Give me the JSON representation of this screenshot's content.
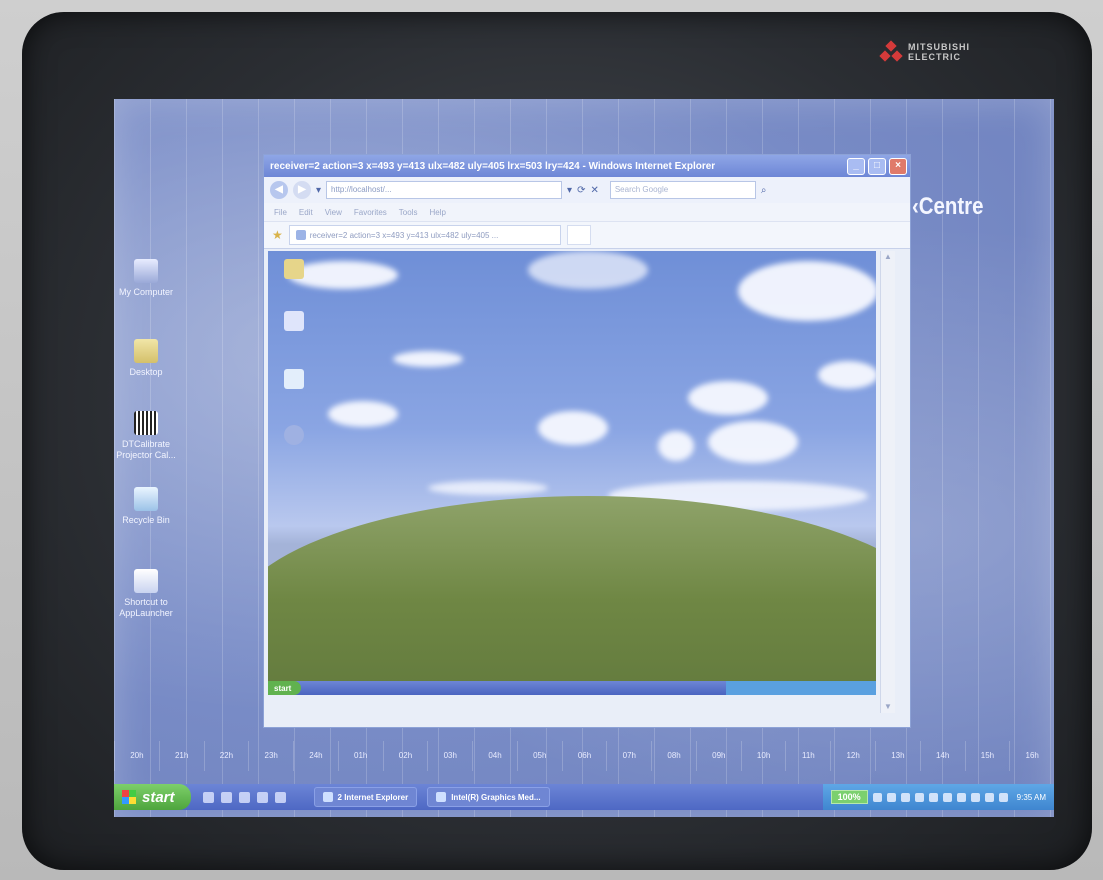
{
  "brand": {
    "monitor_logo_line1": "MITSUBISHI",
    "monitor_logo_line2": "ELECTRIC",
    "wallpaper_text": "‹Centre"
  },
  "desktop_icons": [
    {
      "label": "My Computer"
    },
    {
      "label": "Desktop"
    },
    {
      "label": "DTCalibrate Projector Cal..."
    },
    {
      "label": "Recycle Bin"
    },
    {
      "label": "Shortcut to AppLauncher"
    }
  ],
  "hour_strip": [
    "20h",
    "21h",
    "22h",
    "23h",
    "24h",
    "01h",
    "02h",
    "03h",
    "04h",
    "05h",
    "06h",
    "07h",
    "08h",
    "09h",
    "10h",
    "11h",
    "12h",
    "13h",
    "14h",
    "15h",
    "16h"
  ],
  "taskbar": {
    "start_label": "start",
    "tasks": [
      {
        "label": "2 Internet Explorer"
      },
      {
        "label": "Intel(R) Graphics Med..."
      }
    ],
    "zoom_label": "100%",
    "clock": "9:35 AM"
  },
  "ie": {
    "title": "receiver=2 action=3 x=493 y=413 ulx=482 uly=405 lrx=503 lry=424 - Windows Internet Explorer",
    "address": "http://localhost/...",
    "search_placeholder": "Search Google",
    "menu": [
      "File",
      "Edit",
      "View",
      "Favorites",
      "Tools",
      "Help"
    ],
    "tab_title": "receiver=2 action=3 x=493 y=413 ulx=482 uly=405 ...",
    "inner_start_label": "start"
  },
  "colors": {
    "taskbar": "#4e68c4",
    "start_green": "#4ea53d",
    "wallpaper_blue": "#7b8ec8"
  }
}
